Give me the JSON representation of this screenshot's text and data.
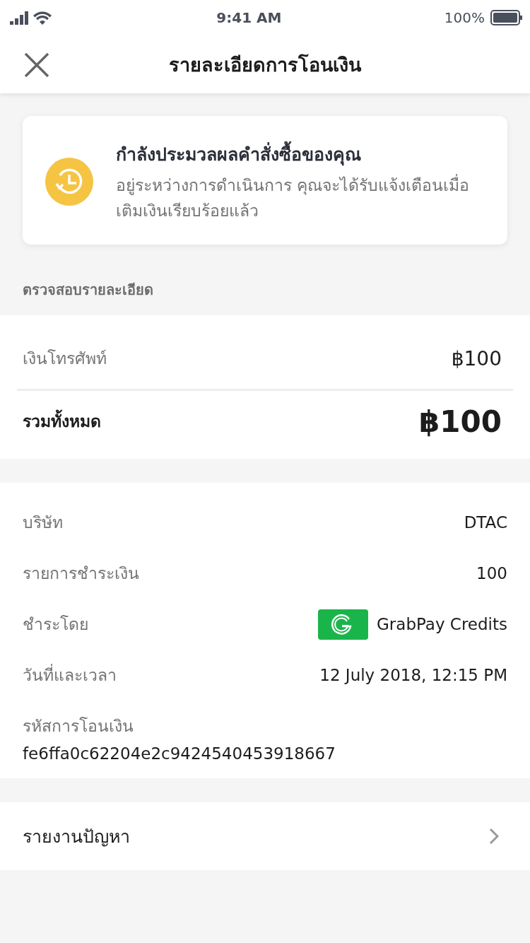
{
  "status_bar": {
    "time": "9:41 AM",
    "battery": "100%"
  },
  "header": {
    "title": "รายละเอียดการโอนเงิน"
  },
  "notice": {
    "title": "กำลังประมวลผลคำสั่งซื้อของคุณ",
    "message": "อยู่ระหว่างการดำเนินการ คุณจะได้รับแจ้งเตือนเมื่อเติมเงินเรียบร้อยแล้ว"
  },
  "summary": {
    "heading": "ตรวจสอบรายละเอียด",
    "item": {
      "label": "เงินโทรศัพท์",
      "value": "฿100"
    },
    "total": {
      "label": "รวมทั้งหมด",
      "value": "฿100"
    }
  },
  "details": [
    {
      "kind": "pair",
      "label": "บริษัท",
      "value": "DTAC"
    },
    {
      "kind": "pair",
      "label": "รายการชำระเงิน",
      "value": "100"
    },
    {
      "kind": "payment",
      "label": "ชำระโดย",
      "value": "GrabPay Credits"
    },
    {
      "kind": "pair",
      "label": "วันที่และเวลา",
      "value": "12 July 2018, 12:15 PM"
    },
    {
      "kind": "stacked",
      "label": "รหัสการโอนเงิน",
      "value": "fe6ffa0c62204e2c9424540453918667"
    }
  ],
  "report": {
    "label": "รายงานปัญหา"
  }
}
